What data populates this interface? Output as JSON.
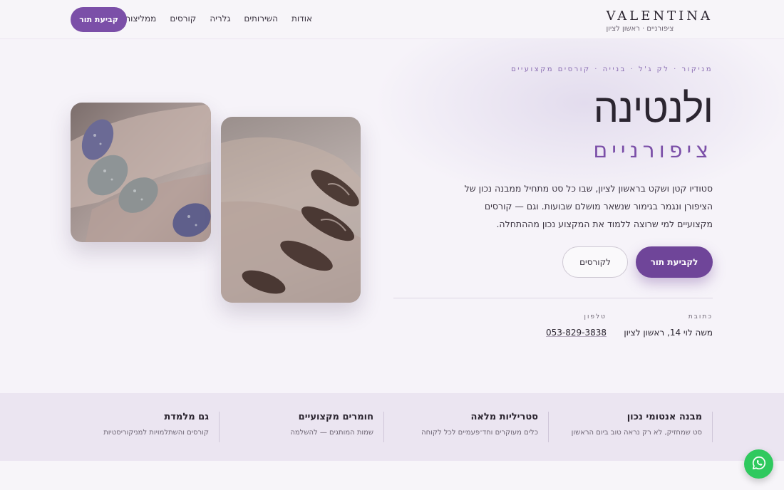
{
  "header": {
    "brand_name": "VALENTINA",
    "brand_sub": "ציפורניים · ראשון לציון",
    "nav": [
      "אודות",
      "השירותים",
      "גלריה",
      "קורסים",
      "ממליצות"
    ],
    "cta": "קביעת תור"
  },
  "hero": {
    "tagline": "מניקור · לק ג'ל · בנייה · קורסים מקצועיים",
    "title": "ולנטינה",
    "subtitle": "ציפורניים",
    "description": "סטודיו קטן ושקט בראשון לציון, שבו כל סט מתחיל ממבנה נכון של הציפורן ונגמר בגימור שנשאר מושלם שבועות. וגם — קורסים מקצועיים למי שרוצה ללמוד את המקצוע נכון מההתחלה.",
    "primary_button": "לקביעת תור",
    "secondary_button": "לקורסים",
    "address_label": "כתובת",
    "address_value": "משה לוי 14, ראשון לציון",
    "phone_label": "טלפון",
    "phone_value": "053-829-3838"
  },
  "features": [
    {
      "title": "מבנה אנטומי נכון",
      "desc": "סט שמחזיק, לא רק נראה טוב ביום הראשון"
    },
    {
      "title": "סטריליות מלאה",
      "desc": "כלים מעוקרים וחד־פעמיים לכל לקוחה"
    },
    {
      "title": "חומרים מקצועיים",
      "desc": "שמות המותגים — להשלמה"
    },
    {
      "title": "גם מלמדת",
      "desc": "קורסים והשתלמויות למניקוריסטיות"
    }
  ],
  "icons": {
    "whatsapp": "whatsapp-icon"
  },
  "colors": {
    "accent": "#7b4fa8",
    "whatsapp": "#2fc95e"
  }
}
